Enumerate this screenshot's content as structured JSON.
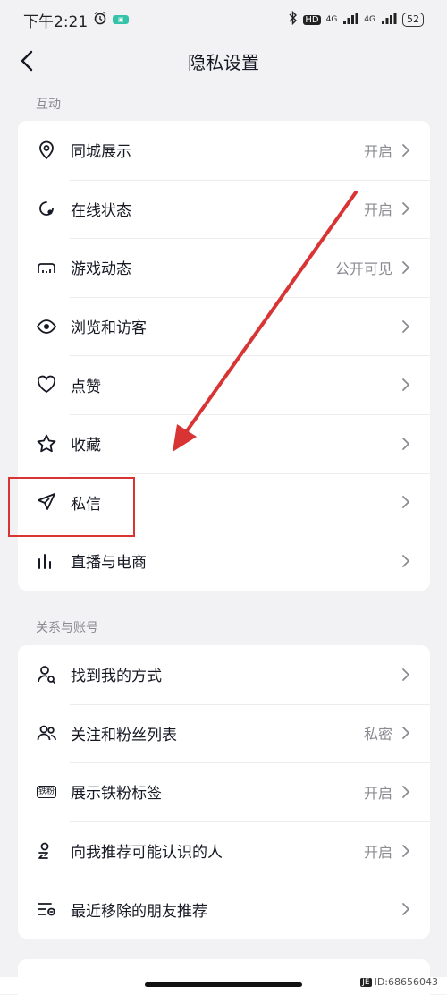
{
  "status_bar": {
    "time": "下午2:21",
    "hd_label": "HD",
    "network_1": "4G",
    "network_2": "4G",
    "battery": "52"
  },
  "nav": {
    "title": "隐私设置"
  },
  "sections": [
    {
      "label": "互动",
      "items": [
        {
          "label": "同城展示",
          "value": "开启",
          "icon": "location-pin-icon"
        },
        {
          "label": "在线状态",
          "value": "开启",
          "icon": "online-status-icon"
        },
        {
          "label": "游戏动态",
          "value": "公开可见",
          "icon": "game-controller-icon"
        },
        {
          "label": "浏览和访客",
          "value": "",
          "icon": "eye-icon"
        },
        {
          "label": "点赞",
          "value": "",
          "icon": "heart-icon"
        },
        {
          "label": "收藏",
          "value": "",
          "icon": "star-icon"
        },
        {
          "label": "私信",
          "value": "",
          "icon": "paper-plane-icon"
        },
        {
          "label": "直播与电商",
          "value": "",
          "icon": "bar-chart-icon"
        }
      ]
    },
    {
      "label": "关系与账号",
      "items": [
        {
          "label": "找到我的方式",
          "value": "",
          "icon": "find-user-icon"
        },
        {
          "label": "关注和粉丝列表",
          "value": "私密",
          "icon": "users-icon"
        },
        {
          "label": "展示铁粉标签",
          "value": "开启",
          "icon": "fan-badge-icon",
          "badge_text": "铁粉"
        },
        {
          "label": "向我推荐可能认识的人",
          "value": "开启",
          "icon": "recommend-user-icon"
        },
        {
          "label": "最近移除的朋友推荐",
          "value": "",
          "icon": "removed-list-icon"
        }
      ]
    }
  ],
  "watermark": {
    "logo": "JE",
    "id_text": "ID:68656043"
  },
  "colors": {
    "background": "#f2f2f4",
    "card": "#ffffff",
    "text": "#161823",
    "secondary": "#8a8b91",
    "annotation": "#d93434"
  }
}
